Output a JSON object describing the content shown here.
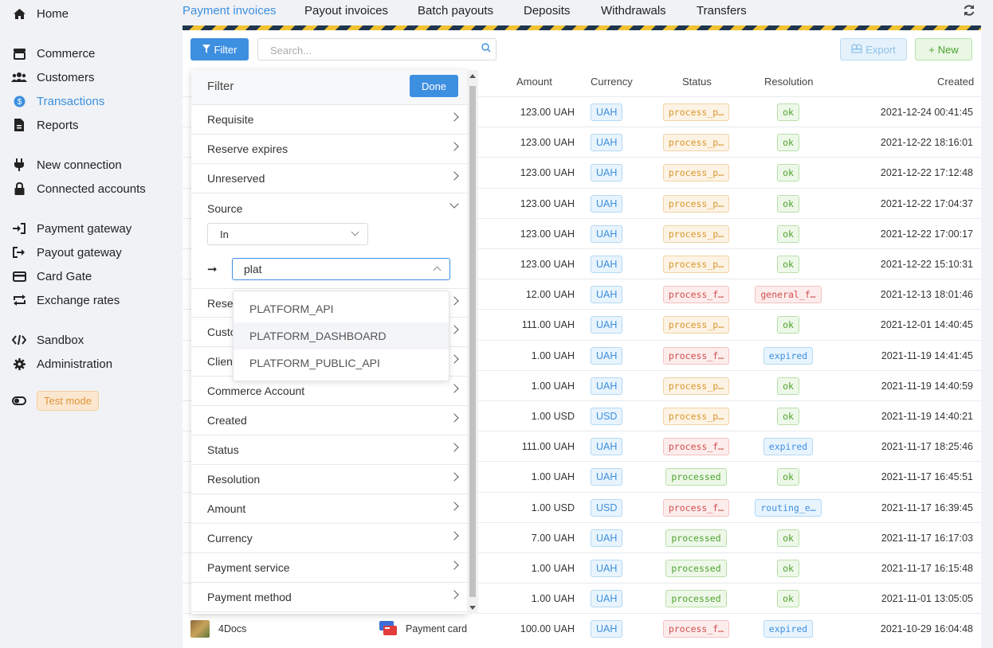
{
  "sidebar": {
    "items": [
      {
        "label": "Home",
        "icon": "home-icon"
      },
      {
        "label": "Commerce",
        "icon": "store-icon"
      },
      {
        "label": "Customers",
        "icon": "users-icon"
      },
      {
        "label": "Transactions",
        "icon": "dollar-icon",
        "active": true
      },
      {
        "label": "Reports",
        "icon": "report-icon"
      },
      {
        "label": "New connection",
        "icon": "plug-icon"
      },
      {
        "label": "Connected accounts",
        "icon": "lock-icon"
      },
      {
        "label": "Payment gateway",
        "icon": "sign-in-icon"
      },
      {
        "label": "Payout gateway",
        "icon": "sign-out-icon"
      },
      {
        "label": "Card Gate",
        "icon": "card-icon"
      },
      {
        "label": "Exchange rates",
        "icon": "exchange-icon"
      },
      {
        "label": "Sandbox",
        "icon": "code-icon"
      },
      {
        "label": "Administration",
        "icon": "gear-icon"
      },
      {
        "label": "",
        "icon": "toggle-icon"
      }
    ],
    "test_mode_label": "Test mode"
  },
  "tabs": [
    {
      "label": "Payment invoices",
      "active": true
    },
    {
      "label": "Payout invoices"
    },
    {
      "label": "Batch payouts"
    },
    {
      "label": "Deposits"
    },
    {
      "label": "Withdrawals"
    },
    {
      "label": "Transfers"
    }
  ],
  "toolbar": {
    "filter_label": "Filter",
    "search_placeholder": "Search...",
    "export_label": "Export",
    "new_label": "New"
  },
  "table": {
    "columns": {
      "amount": "Amount",
      "currency": "Currency",
      "status": "Status",
      "resolution": "Resolution",
      "created": "Created"
    },
    "rows": [
      {
        "amount": "123.00 UAH",
        "currency": "UAH",
        "status": "process_p…",
        "status_kind": "warn",
        "resolution": "ok",
        "res_kind": "ok",
        "created": "2021-12-24 00:41:45"
      },
      {
        "amount": "123.00 UAH",
        "currency": "UAH",
        "status": "process_p…",
        "status_kind": "warn",
        "resolution": "ok",
        "res_kind": "ok",
        "created": "2021-12-22 18:16:01"
      },
      {
        "amount": "123.00 UAH",
        "currency": "UAH",
        "status": "process_p…",
        "status_kind": "warn",
        "resolution": "ok",
        "res_kind": "ok",
        "created": "2021-12-22 17:12:48"
      },
      {
        "amount": "123.00 UAH",
        "currency": "UAH",
        "status": "process_p…",
        "status_kind": "warn",
        "resolution": "ok",
        "res_kind": "ok",
        "created": "2021-12-22 17:04:37"
      },
      {
        "amount": "123.00 UAH",
        "currency": "UAH",
        "status": "process_p…",
        "status_kind": "warn",
        "resolution": "ok",
        "res_kind": "ok",
        "created": "2021-12-22 17:00:17"
      },
      {
        "amount": "123.00 UAH",
        "currency": "UAH",
        "status": "process_p…",
        "status_kind": "warn",
        "resolution": "ok",
        "res_kind": "ok",
        "created": "2021-12-22 15:10:31"
      },
      {
        "amount": "12.00 UAH",
        "currency": "UAH",
        "status": "process_f…",
        "status_kind": "err",
        "resolution": "general_f…",
        "res_kind": "err",
        "created": "2021-12-13 18:01:46"
      },
      {
        "amount": "111.00 UAH",
        "currency": "UAH",
        "status": "process_p…",
        "status_kind": "warn",
        "resolution": "ok",
        "res_kind": "ok",
        "created": "2021-12-01 14:40:45"
      },
      {
        "amount": "1.00 UAH",
        "currency": "UAH",
        "status": "process_f…",
        "status_kind": "err",
        "resolution": "expired",
        "res_kind": "info",
        "created": "2021-11-19 14:41:45"
      },
      {
        "amount": "1.00 UAH",
        "currency": "UAH",
        "status": "process_p…",
        "status_kind": "warn",
        "resolution": "ok",
        "res_kind": "ok",
        "created": "2021-11-19 14:40:59"
      },
      {
        "amount": "1.00 USD",
        "currency": "USD",
        "status": "process_p…",
        "status_kind": "warn",
        "resolution": "ok",
        "res_kind": "ok",
        "created": "2021-11-19 14:40:21"
      },
      {
        "amount": "111.00 UAH",
        "currency": "UAH",
        "status": "process_f…",
        "status_kind": "err",
        "resolution": "expired",
        "res_kind": "info",
        "created": "2021-11-17 18:25:46"
      },
      {
        "amount": "1.00 UAH",
        "currency": "UAH",
        "status": "processed",
        "status_kind": "ok",
        "resolution": "ok",
        "res_kind": "ok",
        "created": "2021-11-17 16:45:51"
      },
      {
        "amount": "1.00 USD",
        "currency": "USD",
        "status": "process_f…",
        "status_kind": "err",
        "resolution": "routing_e…",
        "res_kind": "info",
        "created": "2021-11-17 16:39:45"
      },
      {
        "amount": "7.00 UAH",
        "currency": "UAH",
        "status": "processed",
        "status_kind": "ok",
        "resolution": "ok",
        "res_kind": "ok",
        "created": "2021-11-17 16:17:03"
      },
      {
        "amount": "1.00 UAH",
        "currency": "UAH",
        "status": "processed",
        "status_kind": "ok",
        "resolution": "ok",
        "res_kind": "ok",
        "created": "2021-11-17 16:15:48"
      },
      {
        "amount": "1.00 UAH",
        "currency": "UAH",
        "status": "processed",
        "status_kind": "ok",
        "resolution": "ok",
        "res_kind": "ok",
        "created": "2021-11-01 13:05:05"
      },
      {
        "amount": "100.00 UAH",
        "currency": "UAH",
        "status": "process_f…",
        "status_kind": "err",
        "resolution": "expired",
        "res_kind": "info",
        "created": "2021-10-29 16:04:48",
        "commerce": "4Docs",
        "method": "Payment card"
      }
    ]
  },
  "filter": {
    "title": "Filter",
    "done_label": "Done",
    "items_top": [
      "Requisite",
      "Reserve expires",
      "Unreserved",
      "Source"
    ],
    "source_operator": "In",
    "source_query": "plat",
    "items_partial": [
      "Reser",
      "Custo",
      "Clien"
    ],
    "items_bottom": [
      "Commerce Account",
      "Created",
      "Status",
      "Resolution",
      "Amount",
      "Currency",
      "Payment service",
      "Payment method"
    ],
    "suggestions": [
      "PLATFORM_API",
      "PLATFORM_DASHBOARD",
      "PLATFORM_PUBLIC_API"
    ]
  }
}
